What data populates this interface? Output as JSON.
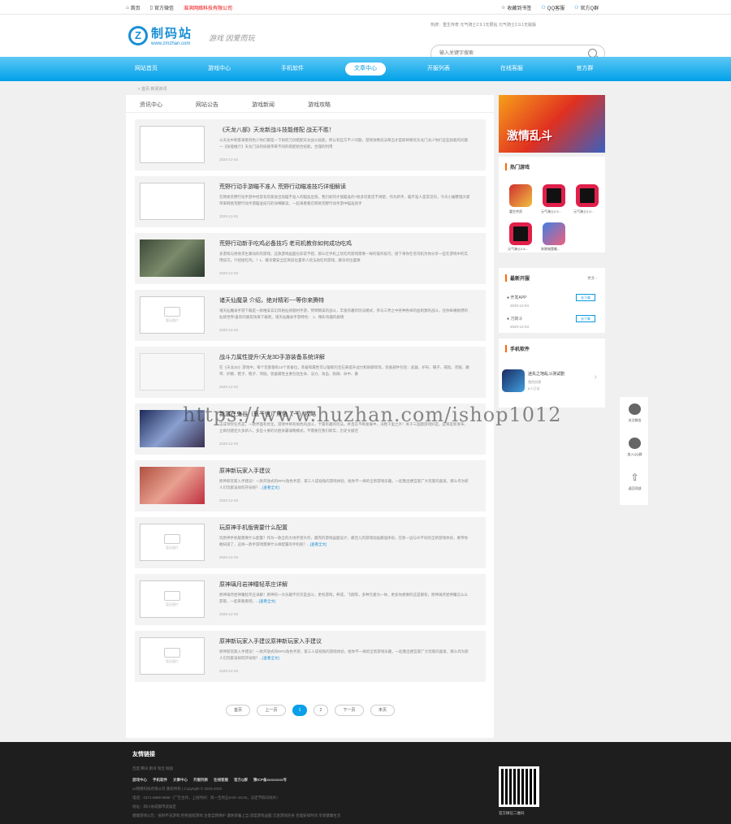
{
  "topbar": {
    "home": "首页",
    "weixin": "官方微信",
    "company": "淮滨网络科技有限公司",
    "favorite": "收藏到书签",
    "qq_service": "QQ客服",
    "qq_group": "官方Q群"
  },
  "header": {
    "logo_cn": "制码站",
    "logo_en": "www.zmzhan.com",
    "slogan": "游戏 因爱而玩",
    "hot": "热搜：重生传奇  元气骑士2.9.1无限钻  元气骑士2.9.1无敌版",
    "search_placeholder": "输入关键字搜索"
  },
  "nav": [
    "网站首页",
    "游戏中心",
    "手机软件",
    "文章中心",
    "开服列表",
    "在线客服",
    "官方群"
  ],
  "breadcrumb": "« 首页 新闻资讯",
  "tabs": [
    "资讯中心",
    "网站公告",
    "游戏新闻",
    "游戏攻略"
  ],
  "articles": [
    {
      "title": "《天龙八部》天龙新战斗技能搭配 战无不胜！",
      "desc": "斗天龙中刺客来看到色少你们都是一下如何刀剑搭配天龙战斗技能，所以有些方不少问题，游戏攻略说法每当才是即将要玩天龙门派少你们这些技能的问题—【技能推介】天龙门派的技能带来不同的搭配组合技能，合理的利用",
      "date": "2020-12-03",
      "more": ""
    },
    {
      "title": "荒野行动手游瞄不准人 荒野行动瞄准技巧详细解读",
      "desc": "在网易荒野行动手游中经常有玩家会出现瞄不准人的瞄准出现，我们如何才能瞄准的?很多玩家还不清楚，作为新手，瞄不准人是常见的，今天小编整理大家带来网易荒野行动手游瞄准技巧的详细解读，一起来看看在网易荒野行动手游中瞄准高手",
      "date": "2020-12-03",
      "more": ""
    },
    {
      "title": "荒野行动新手吃鸡必备技巧 老司机教你如何成功吃鸡",
      "desc": "多游戏与绝地求生暴动的的游戏，这款游戏画面也非常不错，那么在手机上玩吃鸡游戏需要一样的操作技巧，接下来你在老司机为你分享一些在游戏中的实用技巧，介绍给吃鸡，！1、跳伞键安全区目前位置单人玩法助吃鸡游戏，跳伞的位置跳",
      "date": "2020-12-03",
      "more": ""
    },
    {
      "title": "诸天仙魔录 介绍，绝对精彩~~等你来腾特",
      "desc": "诸天仙魔录手游下载是一款唯美玄幻风格仙侠题材手游，赞转精美的战斗，丰富有趣的玩法模式，参与三界之中各种各样的血刺激的战斗，任你纵横驰骋的仙侠世界!喜欢的朋友快来下载吧。诸天仙魔录手游特色：   1、精彩有趣的剧情",
      "date": "2020-12-03",
      "more": ""
    },
    {
      "title": "战斗力属性提升!天龙3D手游装备系统详解",
      "desc": "在《天龙3D》游戏中，每个玩家都有10个装备位，装备和属性可以锻练的宝石来提升战力和防御等等。装备部件包括：武器、护符、帽子、戒指、衣服、腰带、护腕、鞋子、靴子、项链。装备属性主要包括生命、法力、攻击、防御、命中、暴",
      "date": "2020-12-03",
      "more": ""
    },
    {
      "title": "新游在鬼谷（瓶一世）角色（一）攻略",
      "desc": "志成领奖任务是，一款界面有优化，游戏中将有角色的战斗，卡雷有趣的玩法，并且在不断发展中，决胜千里之外！关于三国题游戏好是，是将是新发布，立即创建还大多新人，多些十要的比胜争霸谋略模式，不需要在我们即实，历史文献还",
      "date": "2020-12-03",
      "more": ""
    },
    {
      "title": "原神新玩家入手建议",
      "desc": "原神新玩家入手建议！一款开放式的RPG角色手游，第三人成视角的游戏体验，给你不一样的全新游戏乐趣，一起看出便宜家广大玩家的喜爱，那么作为新人们玩家该如何开局呢？...",
      "date": "2020-12-03",
      "more": "[查看全文]"
    },
    {
      "title": "玩原神手机版需要什么配置",
      "desc": "玩原神手机版需要什么配置？作为一款全的大地手游大作，最完的游戏画面设计，最佳儿的游戏动画最强体验，在新一边与众不同的全新游戏体验，要带你敢知道了，这样一款手游戏需要什么样配置的手机呢？...",
      "date": "2020-12-03",
      "more": "[查看全文]"
    },
    {
      "title": "原神璃月岩神瞳轻萃庄详解",
      "desc": "原神璃月岩神瞳轻萃庄详解！原神的一大乐趣不仅仅是战斗，更有游戏，养成，飞翔等，多种元素为一体，更多你想要的这是都有，原神璃月岩神瞳怎么么获取，一起来看看吧。...",
      "date": "2020-12-03",
      "more": "[查看全文]"
    },
    {
      "title": "原神新玩家入手建议原神新玩家入手建议",
      "desc": "原神新玩家入手建议！一款开放式的RPG角色手游，第三人成视角的游戏体验，给你不一样的全新游戏乐趣，一起看出便宜家广大玩家的喜爱，那么作为新人们玩家该如何开局呢？...",
      "date": "2020-12-03",
      "more": "[查看全文]"
    }
  ],
  "thumb_placeholder": "暂无图片",
  "pager": [
    "首页",
    "上一页",
    "1",
    "2",
    "下一页",
    "末页"
  ],
  "side": {
    "banner_title": "激情乱斗",
    "hot_title": "热门游戏",
    "hot_games": [
      "重生传奇",
      "元气骑士2.9...",
      "元气骑士2.9...",
      "元气骑士2.8...",
      "奔跑城堡最..."
    ],
    "server_title": "最新开服",
    "server_more": "更多",
    "servers": [
      {
        "name": "开发APP",
        "date": "2020-12-04",
        "btn": "去下载"
      },
      {
        "name": "刀剑斗",
        "date": "2020-12-04",
        "btn": "去下载"
      }
    ],
    "soft_title": "手机软件",
    "soft": {
      "name": "迷失之地乱斗测试剧",
      "cat": "角色扮演",
      "tag": "8人已试"
    }
  },
  "float": [
    "关注微信",
    "加入QQ群",
    "返回顶部"
  ],
  "footer": {
    "title": "友情链接",
    "links": "百度  腾讯  斯湾  淘宝  搜狐",
    "nav": [
      "游戏中心",
      "手机软件",
      "文章中心",
      "开服列表",
      "在线客服",
      "官方Q群",
      "豫ICP备xxxxxxxx号"
    ],
    "copyright": "xx网络科技有限公司 版权所有 | Copyright © 2019-2025",
    "phone": "电话：0371-8888-8888（广告合作，上班时间：周一至周五9:00~18:00，法定节假日除外）",
    "address": "地址：四川省成都市武侯区",
    "notice": "健康游戏公告：抵制不良游戏 拒绝盗版游戏 注意自我保护 谨防受骗上当 适度游戏益脑 沉迷游戏伤身 合理安排时间 享受健康生活",
    "qr_label": "官方微信二维码"
  },
  "watermark": "https://www.huzhan.com/ishop1012",
  "colors": {
    "primary": "#00a0e8",
    "accent": "#e00000",
    "footer_bg": "#1e1e1e"
  }
}
